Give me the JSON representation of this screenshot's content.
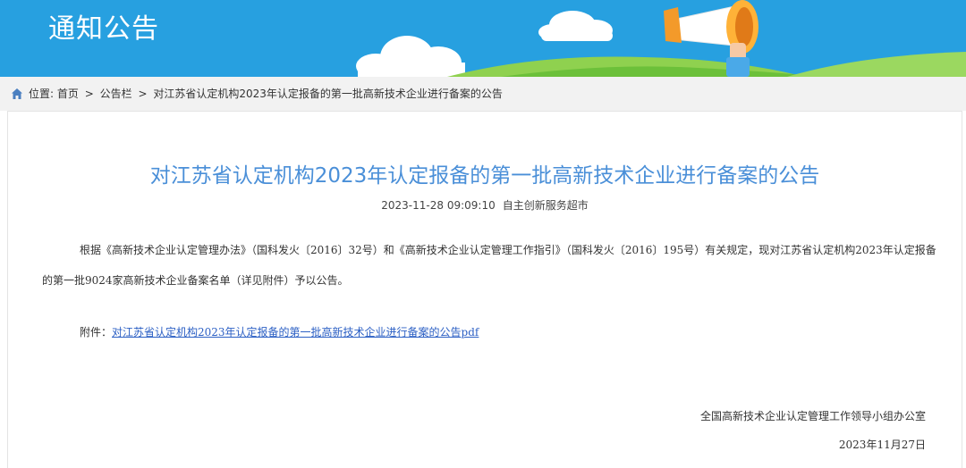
{
  "banner": {
    "title": "通知公告"
  },
  "breadcrumb": {
    "prefix": "位置:",
    "home": "首页",
    "separator": ">",
    "section": "公告栏",
    "current": "对江苏省认定机构2023年认定报备的第一批高新技术企业进行备案的公告"
  },
  "article": {
    "title": "对江苏省认定机构2023年认定报备的第一批高新技术企业进行备案的公告",
    "datetime": "2023-11-28 09:09:10",
    "source": "自主创新服务超市",
    "paragraph": "根据《高新技术企业认定管理办法》（国科发火〔2016〕32号）和《高新技术企业认定管理工作指引》（国科发火〔2016〕195号）有关规定，现对江苏省认定机构2023年认定报备的第一批9024家高新技术企业备案名单（详见附件）予以公告。",
    "attachment_label": "附件：",
    "attachment_link": "对江苏省认定机构2023年认定报备的第一批高新技术企业进行备案的公告pdf",
    "signature_org": "全国高新技术企业认定管理工作领导小组办公室",
    "signature_date": "2023年11月27日"
  },
  "colors": {
    "banner_bg": "#27a0e0",
    "title_blue": "#4a8fd8",
    "link_blue": "#2b5fc4",
    "breadcrumb_bg": "#f2f2f2"
  },
  "icons": {
    "breadcrumb_icon": "home-icon",
    "banner_icon": "megaphone-icon"
  }
}
